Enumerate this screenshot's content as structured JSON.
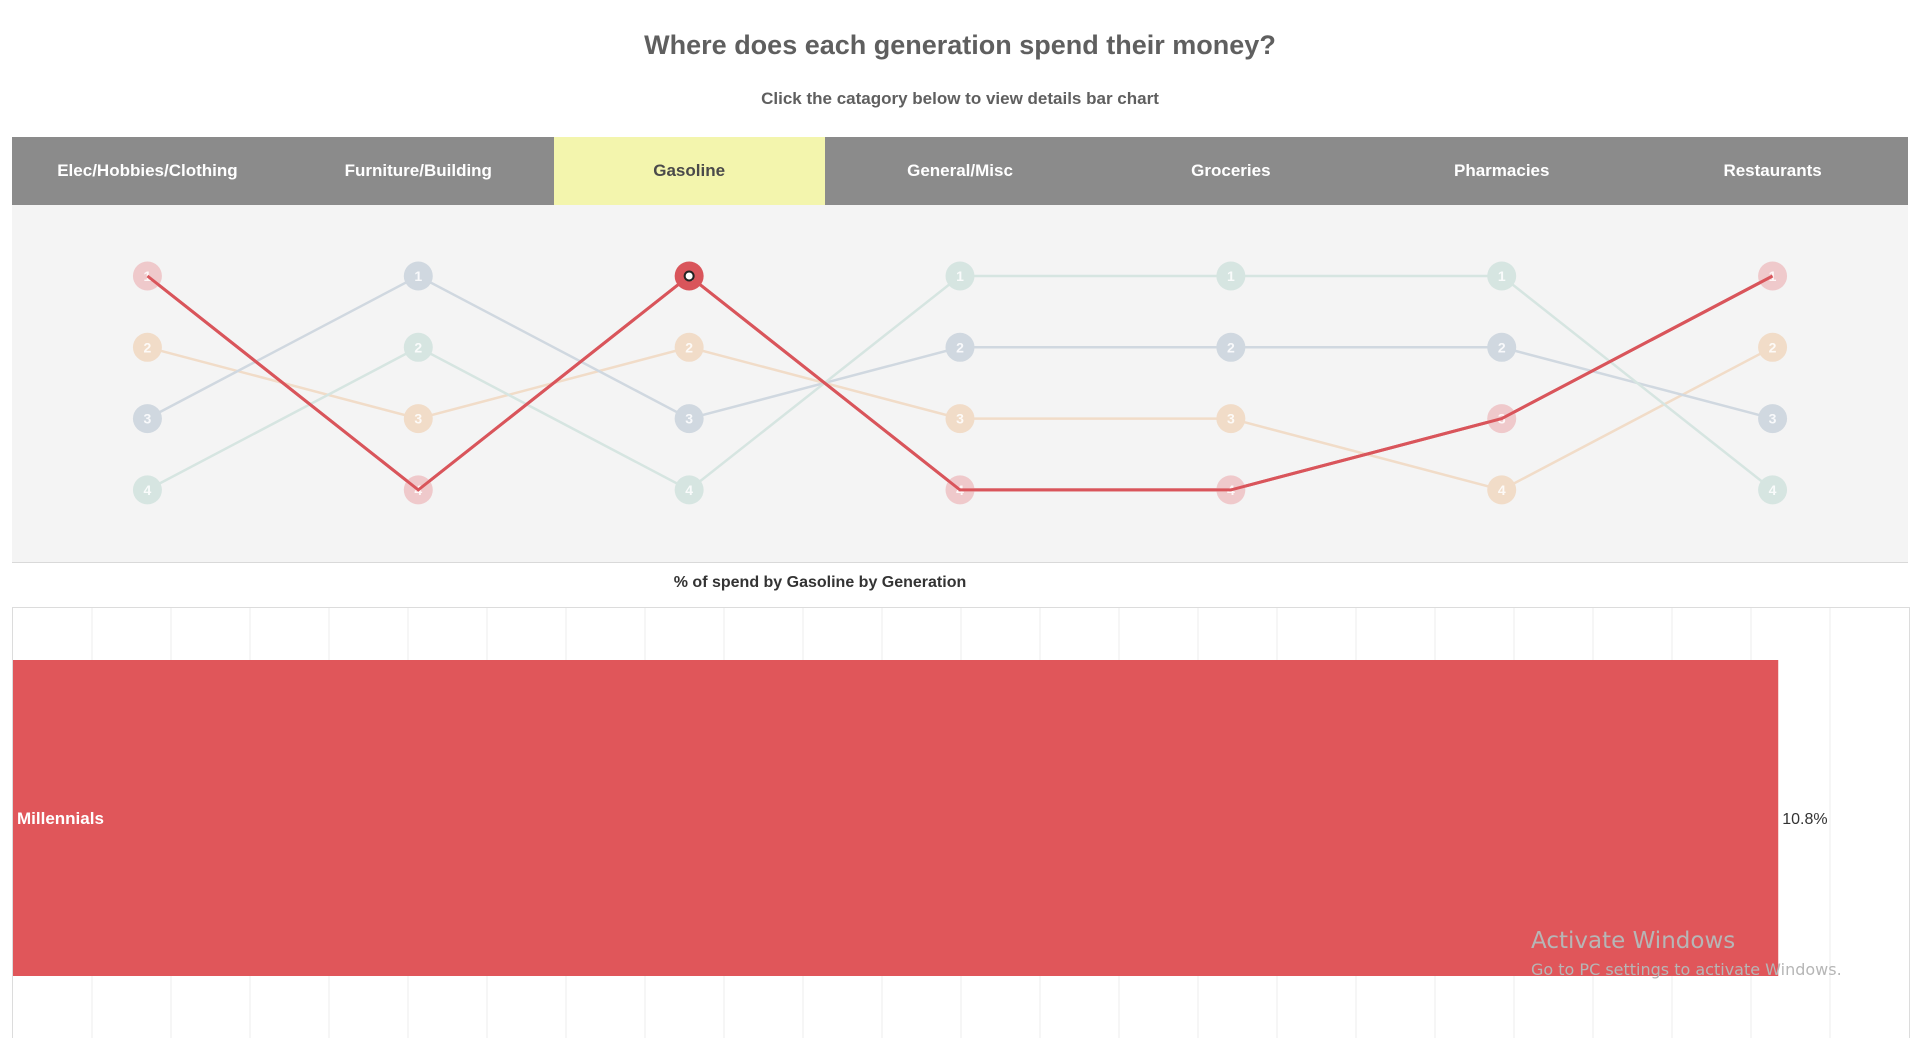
{
  "header": {
    "title": "Where does each generation spend their money?",
    "subtitle": "Click the catagory below to view details bar chart"
  },
  "tabs": [
    {
      "label": "Elec/Hobbies/Clothing",
      "active": false
    },
    {
      "label": "Furniture/Building",
      "active": false
    },
    {
      "label": "Gasoline",
      "active": true
    },
    {
      "label": "General/Misc",
      "active": false
    },
    {
      "label": "Groceries",
      "active": false
    },
    {
      "label": "Pharmacies",
      "active": false
    },
    {
      "label": "Restaurants",
      "active": false
    }
  ],
  "colors": {
    "highlight": "#d9555b",
    "active_tab": "#f3f5ad",
    "tab_bar": "#8b8b8b",
    "bar": "#e0565a"
  },
  "chart_data": [
    {
      "type": "line",
      "subtype": "bump",
      "categories": [
        "Elec/Hobbies/Clothing",
        "Furniture/Building",
        "Gasoline",
        "General/Misc",
        "Groceries",
        "Pharmacies",
        "Restaurants"
      ],
      "y_reversed": true,
      "ylim": [
        1,
        4
      ],
      "highlighted_series": 0,
      "series": [
        {
          "values": [
            1,
            4,
            1,
            4,
            4,
            3,
            1
          ],
          "color": "#d9555b",
          "faded_color": "#efc9cb"
        },
        {
          "values": [
            2,
            3,
            2,
            3,
            3,
            4,
            2
          ],
          "color": "#f0c29c",
          "faded_color": "#f1dcc8"
        },
        {
          "values": [
            3,
            1,
            3,
            2,
            2,
            2,
            3
          ],
          "color": "#b9c6d3",
          "faded_color": "#d0d8e0"
        },
        {
          "values": [
            4,
            2,
            4,
            1,
            1,
            1,
            4
          ],
          "color": "#c2dcd6",
          "faded_color": "#d6e5e1"
        }
      ]
    },
    {
      "type": "bar",
      "orientation": "horizontal",
      "title": "% of spend by Gasoline by Generation",
      "categories": [
        "Millennials"
      ],
      "values": [
        10.8
      ],
      "value_labels": [
        "10.8%"
      ],
      "xlim": [
        0,
        11.6
      ],
      "grid": true
    }
  ],
  "watermark": {
    "line1": "Activate Windows",
    "line2": "Go to PC settings to activate Windows."
  }
}
